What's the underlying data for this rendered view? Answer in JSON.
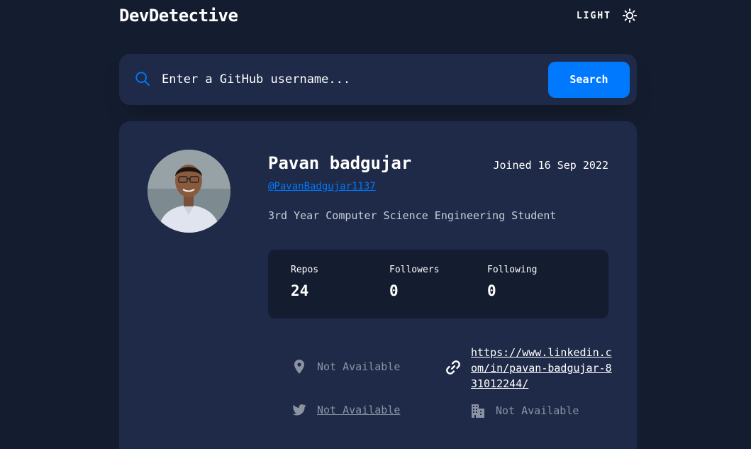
{
  "app": {
    "title": "DevDetective"
  },
  "theme_toggle": {
    "label": "LIGHT",
    "icon": "sun-icon"
  },
  "search": {
    "placeholder": "Enter a GitHub username...",
    "button_label": "Search"
  },
  "profile": {
    "name": "Pavan badgujar",
    "login": "@PavanBadgujar1137",
    "joined": "Joined 16 Sep 2022",
    "bio": "3rd Year Computer Science Engineering Student",
    "stats": [
      {
        "label": "Repos",
        "value": "24"
      },
      {
        "label": "Followers",
        "value": "0"
      },
      {
        "label": "Following",
        "value": "0"
      }
    ],
    "location": "Not Available",
    "website": "https://www.linkedin.com/in/pavan-badgujar-831012244/",
    "twitter": "Not Available",
    "company": "Not Available"
  },
  "colors": {
    "background": "#141d2f",
    "card": "#1e2a47",
    "accent": "#0079ff",
    "muted": "#8b93a3"
  }
}
